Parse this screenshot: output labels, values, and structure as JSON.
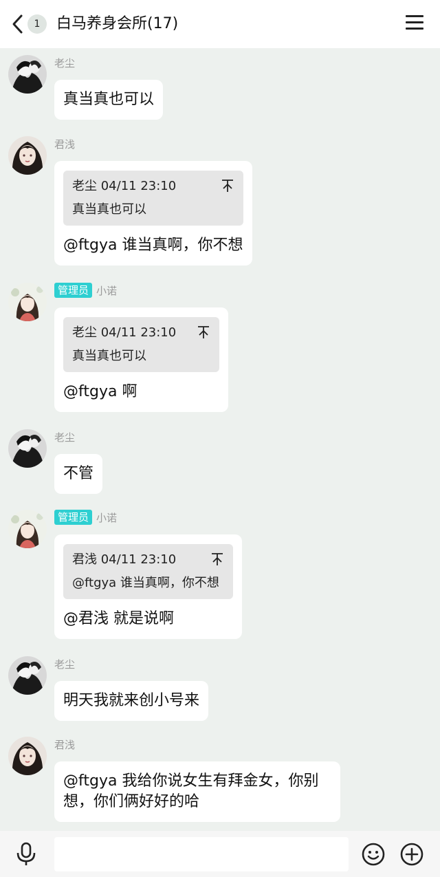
{
  "header": {
    "unread_count": "1",
    "title": "白马养身会所(17)"
  },
  "messages": [
    {
      "sender": "老尘",
      "text": "真当真也可以"
    },
    {
      "sender": "君浅",
      "quote": {
        "head": "老尘 04/11 23:10",
        "text": "真当真也可以"
      },
      "text": "@ftgya 谁当真啊，你不想"
    },
    {
      "sender": "小诺",
      "badge": "管理员",
      "quote": {
        "head": "老尘 04/11 23:10",
        "text": "真当真也可以"
      },
      "text": "@ftgya 啊"
    },
    {
      "sender": "老尘",
      "text": "不管"
    },
    {
      "sender": "小诺",
      "badge": "管理员",
      "quote": {
        "head": "君浅 04/11 23:10",
        "text": "@ftgya 谁当真啊，你不想"
      },
      "text": "@君浅 就是说啊"
    },
    {
      "sender": "老尘",
      "text": "明天我就来创小号来"
    },
    {
      "sender": "君浅",
      "text": "@ftgya 我给你说女生有拜金女，你别想，你们俩好好的哈"
    }
  ],
  "input": {
    "value": "",
    "placeholder": ""
  },
  "icons": {
    "back": "chevron-left-icon",
    "menu": "hamburger-menu-icon",
    "quote": "jump-to-top-icon",
    "voice": "microphone-icon",
    "emoji": "smiley-icon",
    "plus": "plus-circle-icon"
  },
  "colors": {
    "background": "#edf1ee",
    "bubble": "#ffffff",
    "admin_badge": "#2ecfd1",
    "quote_bg": "#e6e6e6"
  }
}
